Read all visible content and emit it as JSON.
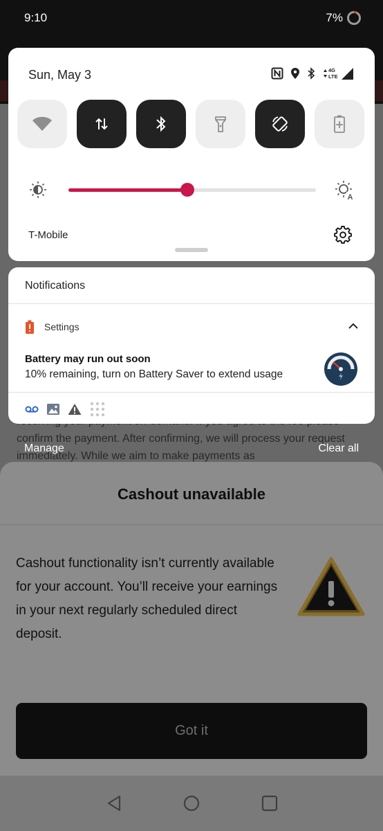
{
  "status_bar": {
    "time": "9:10",
    "battery": "7%"
  },
  "quick_settings": {
    "date": "Sun, May 3",
    "network_badge": "4G\nLTE",
    "carrier": "T-Mobile",
    "brightness_level": 0.48,
    "tiles": [
      {
        "name": "wifi",
        "on": false
      },
      {
        "name": "mobile-data",
        "on": true
      },
      {
        "name": "bluetooth",
        "on": true
      },
      {
        "name": "flashlight",
        "on": false
      },
      {
        "name": "auto-rotate",
        "on": true
      },
      {
        "name": "battery-saver",
        "on": false
      }
    ]
  },
  "notifications": {
    "header": "Notifications",
    "app_name": "Settings",
    "title": "Battery may run out soon",
    "text": "10% remaining, turn on Battery Saver to extend usage",
    "manage_label": "Manage",
    "clear_all_label": "Clear all"
  },
  "background_app": {
    "text": "receiving your payment on-demand. If you agree to the fee please confirm the payment. After confirming, we will process your request immediately. While we aim to make payments as"
  },
  "dialog": {
    "title": "Cashout unavailable",
    "message": "Cashout functionality isn’t currently available for your account. You’ll receive your earnings in your next regularly scheduled direct deposit.",
    "button_label": "Got it"
  },
  "colors": {
    "accent": "#c8174a",
    "tile_on": "#222222",
    "tile_off": "#eeeeee"
  }
}
